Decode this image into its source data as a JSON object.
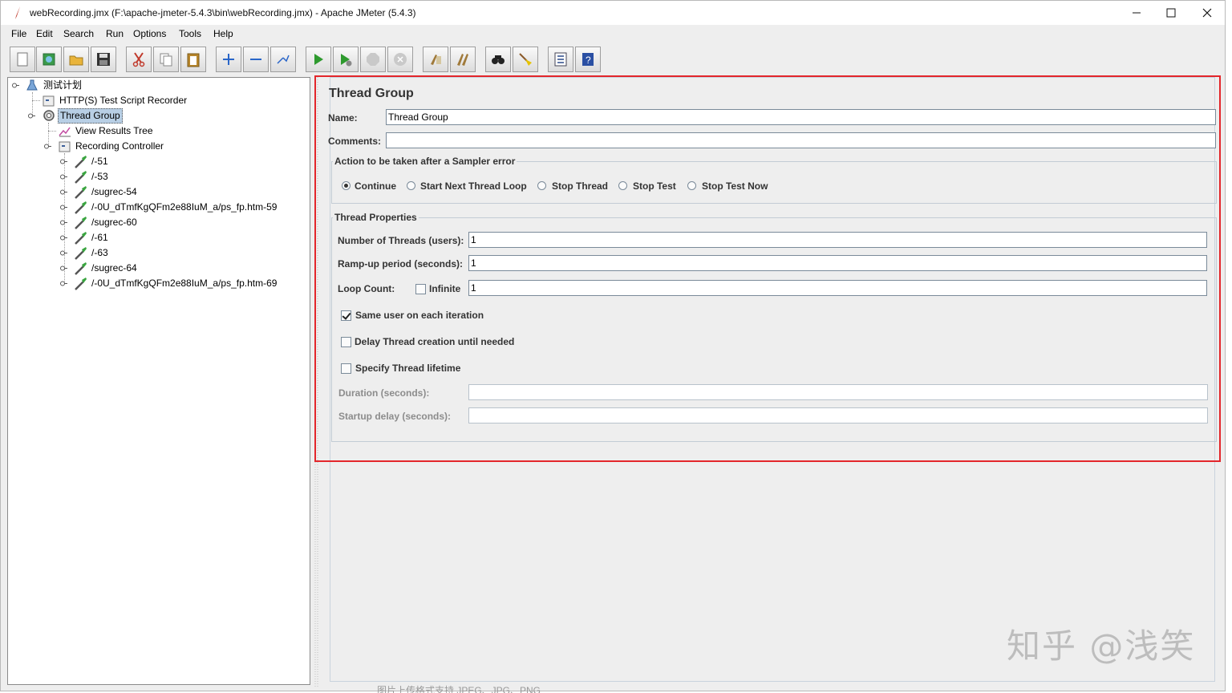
{
  "window": {
    "title": "webRecording.jmx (F:\\apache-jmeter-5.4.3\\bin\\webRecording.jmx) - Apache JMeter (5.4.3)"
  },
  "menu": [
    "File",
    "Edit",
    "Search",
    "Run",
    "Options",
    "Tools",
    "Help"
  ],
  "toolbar": [
    {
      "name": "new-icon"
    },
    {
      "name": "templates-icon"
    },
    {
      "name": "open-icon"
    },
    {
      "name": "save-icon"
    },
    {
      "name": "cut-icon"
    },
    {
      "name": "copy-icon"
    },
    {
      "name": "paste-icon"
    },
    {
      "name": "expand-icon"
    },
    {
      "name": "collapse-icon"
    },
    {
      "name": "toggle-icon"
    },
    {
      "name": "start-icon"
    },
    {
      "name": "start-no-pauses-icon"
    },
    {
      "name": "stop-icon"
    },
    {
      "name": "shutdown-icon"
    },
    {
      "name": "clear-icon"
    },
    {
      "name": "clear-all-icon"
    },
    {
      "name": "search-icon"
    },
    {
      "name": "reset-search-icon"
    },
    {
      "name": "function-helper-icon"
    },
    {
      "name": "help-icon"
    }
  ],
  "tree": {
    "items": [
      {
        "label": "测试计划",
        "level": 0,
        "icon": "test-plan-icon"
      },
      {
        "label": "HTTP(S) Test Script Recorder",
        "level": 1,
        "icon": "recorder-icon"
      },
      {
        "label": "Thread Group",
        "level": 1,
        "icon": "thread-group-icon",
        "selected": true
      },
      {
        "label": "View Results Tree",
        "level": 2,
        "icon": "results-tree-icon"
      },
      {
        "label": "Recording Controller",
        "level": 2,
        "icon": "controller-icon"
      },
      {
        "label": "/-51",
        "level": 3,
        "icon": "sampler-icon"
      },
      {
        "label": "/-53",
        "level": 3,
        "icon": "sampler-icon"
      },
      {
        "label": "/sugrec-54",
        "level": 3,
        "icon": "sampler-icon"
      },
      {
        "label": "/-0U_dTmfKgQFm2e88IuM_a/ps_fp.htm-59",
        "level": 3,
        "icon": "sampler-icon"
      },
      {
        "label": "/sugrec-60",
        "level": 3,
        "icon": "sampler-icon"
      },
      {
        "label": "/-61",
        "level": 3,
        "icon": "sampler-icon"
      },
      {
        "label": "/-63",
        "level": 3,
        "icon": "sampler-icon"
      },
      {
        "label": "/sugrec-64",
        "level": 3,
        "icon": "sampler-icon"
      },
      {
        "label": "/-0U_dTmfKgQFm2e88IuM_a/ps_fp.htm-69",
        "level": 3,
        "icon": "sampler-icon"
      }
    ]
  },
  "panel": {
    "title": "Thread Group",
    "name_label": "Name:",
    "name_value": "Thread Group",
    "comments_label": "Comments:",
    "comments_value": "",
    "error_group_title": "Action to be taken after a Sampler error",
    "error_actions": [
      "Continue",
      "Start Next Thread Loop",
      "Stop Thread",
      "Stop Test",
      "Stop Test Now"
    ],
    "error_selected": "Continue",
    "props_title": "Thread Properties",
    "threads_label": "Number of Threads (users):",
    "threads_value": "1",
    "rampup_label": "Ramp-up period (seconds):",
    "rampup_value": "1",
    "loop_label": "Loop Count:",
    "infinite_label": "Infinite",
    "infinite_checked": false,
    "loop_value": "1",
    "same_user_label": "Same user on each iteration",
    "same_user_checked": true,
    "delay_label": "Delay Thread creation until needed",
    "delay_checked": false,
    "lifetime_label": "Specify Thread lifetime",
    "lifetime_checked": false,
    "duration_label": "Duration (seconds):",
    "duration_value": "",
    "startup_label": "Startup delay (seconds):",
    "startup_value": ""
  },
  "watermark": "知乎 @浅笑",
  "footer_text": "图片上传格式支持 JPEG、JPG、PNG",
  "colors": {
    "highlight_box": "#e3262b",
    "selection": "#b8cfe5"
  }
}
